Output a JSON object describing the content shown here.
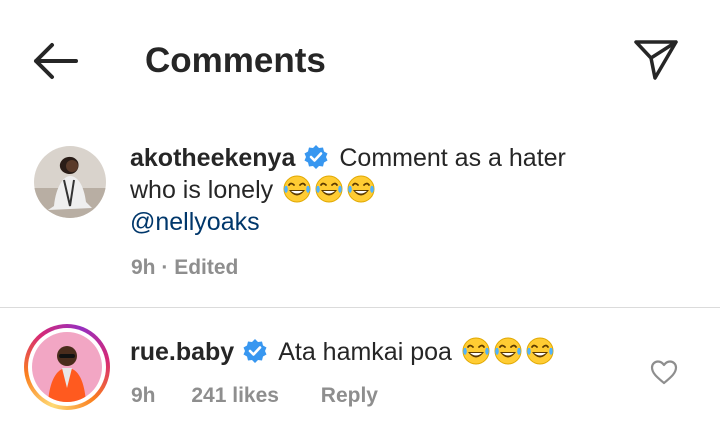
{
  "header": {
    "title": "Comments",
    "back_icon": "arrow-left-icon",
    "send_icon": "paper-plane-icon"
  },
  "caption": {
    "username": "akotheekenya",
    "text_line1": "Comment as a hater",
    "text_line2": "who is lonely",
    "mention": "@nellyoaks",
    "time": "9h",
    "separator": "·",
    "edited": "Edited",
    "verified": true,
    "emoji_count": 3
  },
  "comment": {
    "username": "rue.baby",
    "text": "Ata hamkai poa",
    "time": "9h",
    "likes": "241 likes",
    "reply": "Reply",
    "verified": true,
    "emoji_count": 3,
    "like_icon": "heart-outline-icon"
  },
  "colors": {
    "text": "#262626",
    "muted": "#8e8e8e",
    "verified": "#3897f0",
    "mention": "#00376b",
    "divider": "#dbdbdb"
  }
}
